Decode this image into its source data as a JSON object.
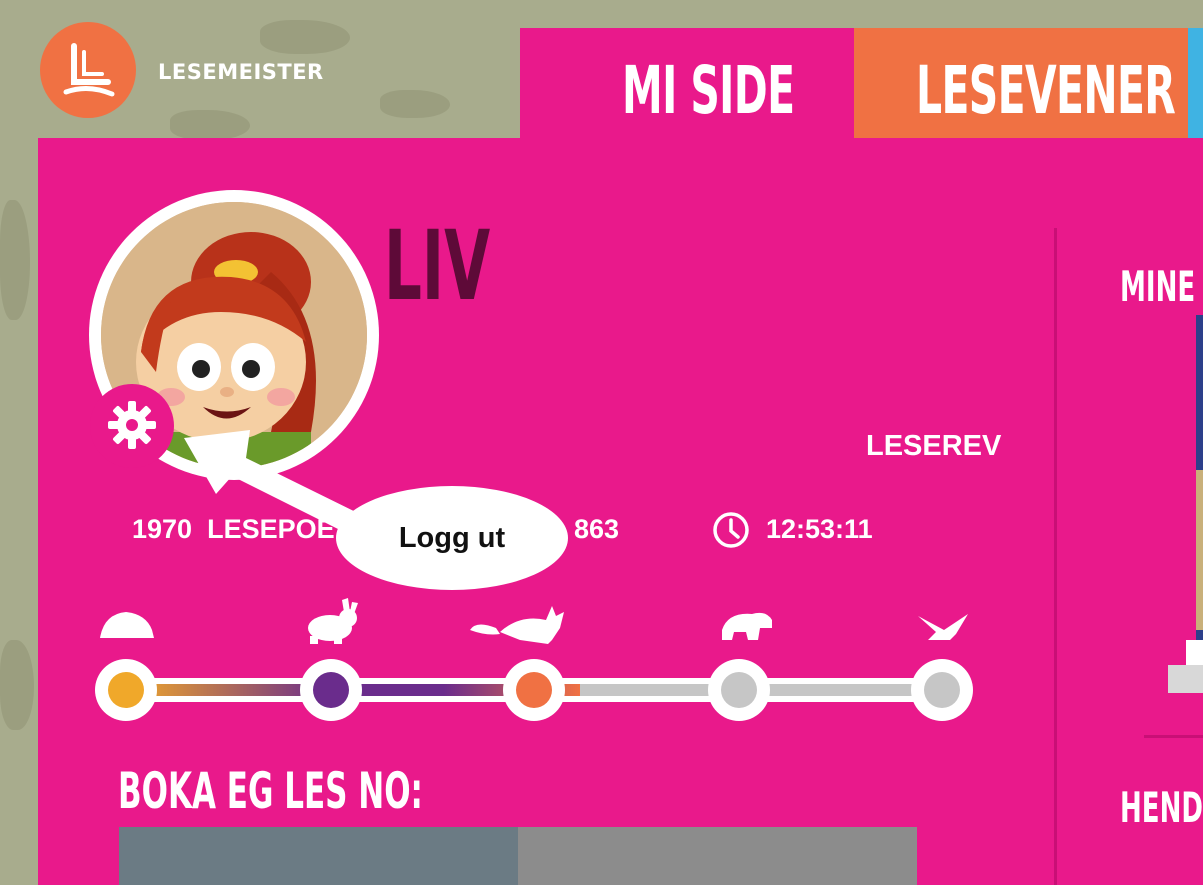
{
  "app": {
    "brand": "LESEMEISTER",
    "logo_icon": "book-logo-icon"
  },
  "tabs": [
    {
      "label": "MI SIDE",
      "active": true,
      "color": "#e9198b"
    },
    {
      "label": "LESEVENER",
      "active": false,
      "color": "#f07143"
    }
  ],
  "profile": {
    "name": "LIV",
    "level_label": "LESEREV",
    "points": "1970",
    "points_label": "LESEPOE",
    "count": "863",
    "time": "12:53:11",
    "settings_icon": "gear-icon",
    "clock_icon": "clock-icon"
  },
  "tooltip": {
    "label": "Logg ut"
  },
  "progress": {
    "levels": [
      "hedgehog",
      "rabbit",
      "fox",
      "bear",
      "bird"
    ],
    "reached": 3,
    "colors": [
      "#f0a82a",
      "#6a2c8c",
      "#f07143",
      "#c6c6c6",
      "#c6c6c6"
    ]
  },
  "sections": {
    "current_book": "BOKA EG LES NO:",
    "my_books": "MINE B",
    "events": "HENDIN"
  },
  "colors": {
    "panel": "#e9198b",
    "orange": "#f07143",
    "name": "#5e0a38",
    "blue": "#3fb3e3"
  }
}
